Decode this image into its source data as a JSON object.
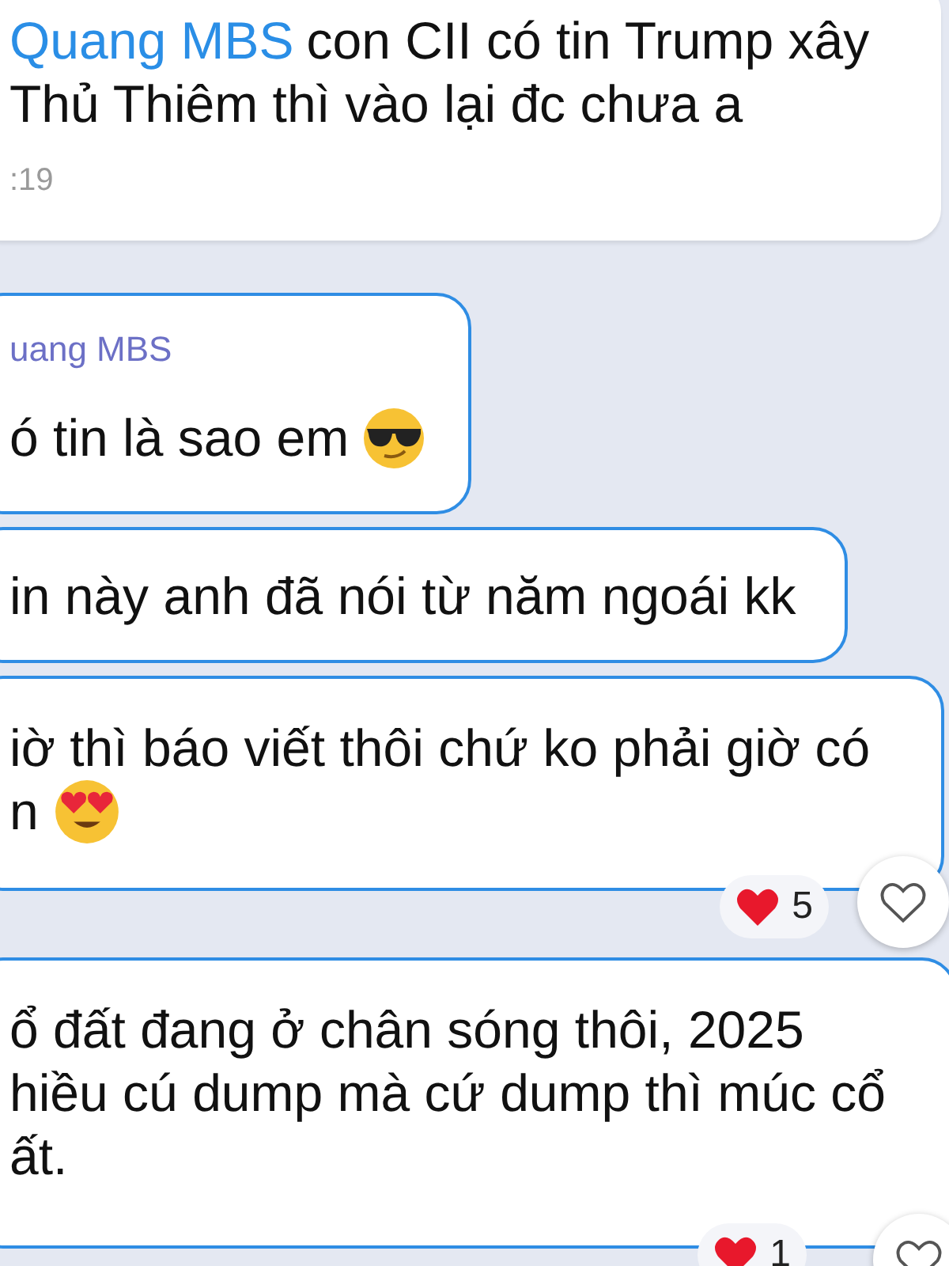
{
  "messages": [
    {
      "highlighted": false,
      "mention": "Quang MBS",
      "lines": [
        {
          "text": "con CII có tin Trump xây"
        },
        {
          "text": "Thủ Thiêm thì vào lại đc chưa a"
        }
      ],
      "time": ":19"
    },
    {
      "highlighted": true,
      "author": "uang MBS",
      "lines": [
        {
          "text": "ó tin là sao em",
          "kind": "sunglasses"
        }
      ]
    },
    {
      "highlighted": true,
      "lines": [
        {
          "text": "in này anh đã nói từ năm ngoái kk"
        }
      ]
    },
    {
      "highlighted": true,
      "lines": [
        {
          "text": "iờ thì báo viết thôi chứ ko phải giờ có"
        },
        {
          "text": "n",
          "kind": "heart-eyes"
        }
      ],
      "reaction": {
        "count": "5",
        "liked": false
      }
    },
    {
      "highlighted": true,
      "lines": [
        {
          "text": "ổ đất đang ở chân sóng thôi, 2025"
        },
        {
          "text": "hiều cú dump mà cứ dump thì múc cổ"
        },
        {
          "text": "ất."
        }
      ],
      "reaction": {
        "count": "1",
        "liked": false
      }
    }
  ]
}
